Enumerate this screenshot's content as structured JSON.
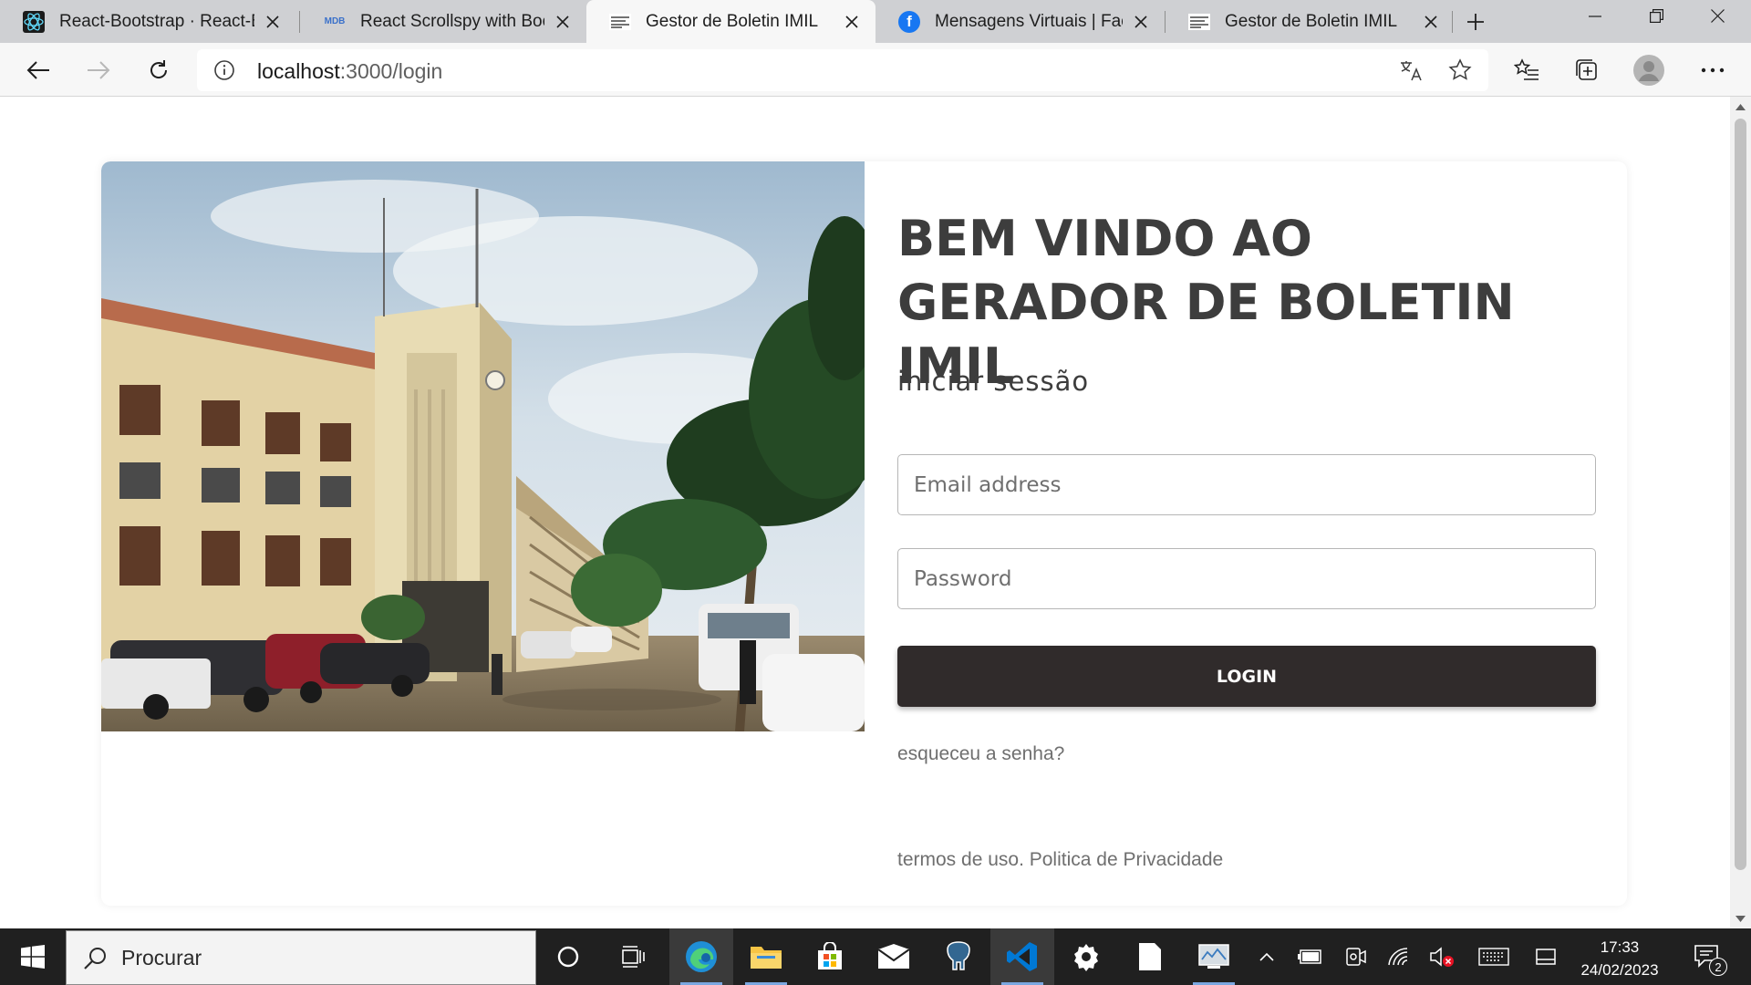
{
  "browser": {
    "tabs": [
      {
        "title": "React-Bootstrap · React-Bo",
        "favicon": "react-bootstrap-logo"
      },
      {
        "title": "React Scrollspy with Bootstr",
        "favicon": "mdb-logo"
      },
      {
        "title": "Gestor de Boletin IMIL",
        "favicon": "imil-logo",
        "active": true
      },
      {
        "title": "Mensagens Virtuais | Faceb",
        "favicon": "facebook-logo"
      },
      {
        "title": "Gestor de Boletin IMIL",
        "favicon": "imil-logo"
      }
    ],
    "url_host": "localhost",
    "url_path": ":3000/login"
  },
  "page": {
    "heading": "BEM VINDO AO GERADOR DE BOLETIN IMIL",
    "subtitle": "iniciar sessão",
    "email_placeholder": "Email address",
    "password_placeholder": "Password",
    "login_label": "LOGIN",
    "forgot_link": "esqueceu a senha?",
    "terms_link": "termos de uso.",
    "privacy_link": "Politica de Privacidade"
  },
  "taskbar": {
    "search_placeholder": "Procurar",
    "time": "17:33",
    "date": "24/02/2023",
    "notification_count": "2"
  },
  "colors": {
    "button_bg": "#302b2b",
    "heading": "#3d3d3d",
    "link": "#6f6f6f",
    "tabbar_bg": "#cfd0d3",
    "taskbar_bg": "#202020"
  }
}
